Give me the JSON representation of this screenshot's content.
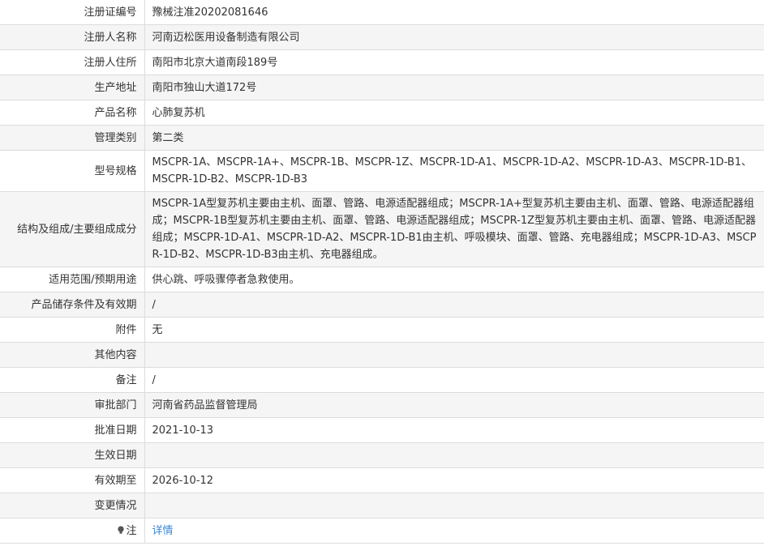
{
  "rows": [
    {
      "label": "注册证编号",
      "value": "豫械注准20202081646"
    },
    {
      "label": "注册人名称",
      "value": "河南迈松医用设备制造有限公司"
    },
    {
      "label": "注册人住所",
      "value": "南阳市北京大道南段189号"
    },
    {
      "label": "生产地址",
      "value": "南阳市独山大道172号"
    },
    {
      "label": "产品名称",
      "value": "心肺复苏机"
    },
    {
      "label": "管理类别",
      "value": "第二类"
    },
    {
      "label": "型号规格",
      "value": "MSCPR-1A、MSCPR-1A+、MSCPR-1B、MSCPR-1Z、MSCPR-1D-A1、MSCPR-1D-A2、MSCPR-1D-A3、MSCPR-1D-B1、MSCPR-1D-B2、MSCPR-1D-B3"
    },
    {
      "label": "结构及组成/主要组成成分",
      "value": "MSCPR-1A型复苏机主要由主机、面罩、管路、电源适配器组成；MSCPR-1A+型复苏机主要由主机、面罩、管路、电源适配器组成；MSCPR-1B型复苏机主要由主机、面罩、管路、电源适配器组成；MSCPR-1Z型复苏机主要由主机、面罩、管路、电源适配器组成；MSCPR-1D-A1、MSCPR-1D-A2、MSCPR-1D-B1由主机、呼吸模块、面罩、管路、充电器组成；MSCPR-1D-A3、MSCPR-1D-B2、MSCPR-1D-B3由主机、充电器组成。"
    },
    {
      "label": "适用范围/预期用途",
      "value": "供心跳、呼吸骤停者急救使用。"
    },
    {
      "label": "产品储存条件及有效期",
      "value": "/"
    },
    {
      "label": "附件",
      "value": "无"
    },
    {
      "label": "其他内容",
      "value": ""
    },
    {
      "label": "备注",
      "value": "/"
    },
    {
      "label": "审批部门",
      "value": "河南省药品监督管理局"
    },
    {
      "label": "批准日期",
      "value": "2021-10-13"
    },
    {
      "label": "生效日期",
      "value": ""
    },
    {
      "label": "有效期至",
      "value": "2026-10-12"
    },
    {
      "label": "变更情况",
      "value": ""
    },
    {
      "label": "注",
      "value": "详情"
    }
  ],
  "icons": {
    "note": "lightbulb-icon"
  },
  "colors": {
    "link": "#3a88d6",
    "border": "#dcdcdc",
    "stripe": "#f5f5f5"
  }
}
